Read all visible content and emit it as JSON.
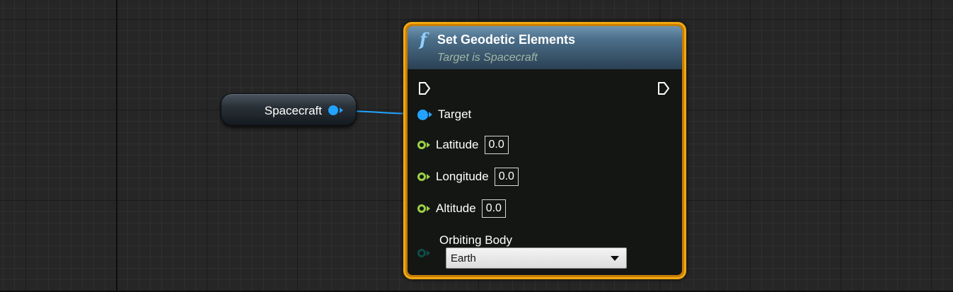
{
  "variable_node": {
    "label": "Spacecraft"
  },
  "function_node": {
    "icon": "function-icon",
    "icon_glyph": "f",
    "title": "Set Geodetic Elements",
    "subtitle": "Target is Spacecraft",
    "pins": {
      "target": {
        "label": "Target"
      },
      "latitude": {
        "label": "Latitude",
        "value": "0.0"
      },
      "longitude": {
        "label": "Longitude",
        "value": "0.0"
      },
      "altitude": {
        "label": "Altitude",
        "value": "0.0"
      },
      "orbiting_body": {
        "label": "Orbiting Body",
        "selected": "Earth"
      }
    }
  },
  "colors": {
    "object_pin": "#21a3ff",
    "float_pin": "#9bd147",
    "enum_pin": "#0f4c46",
    "node_border_selected": "#f2a90f",
    "header_blue": "#4c6f8a",
    "wire": "#21a3ff"
  }
}
